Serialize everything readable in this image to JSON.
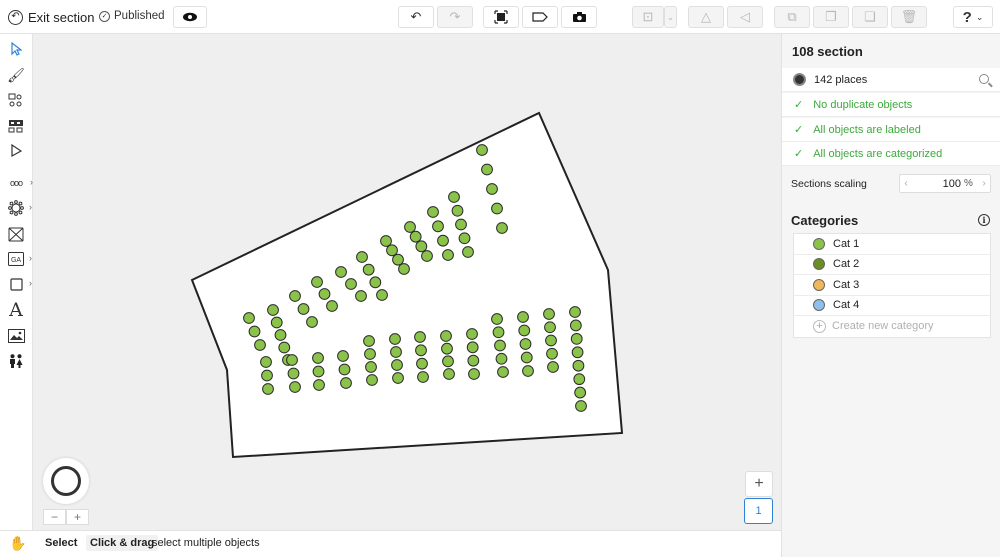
{
  "topbar": {
    "exit_label": "Exit section",
    "published_label": "Published",
    "help_label": "?"
  },
  "icons": {
    "eye": "eye-icon",
    "undo": "undo-icon",
    "redo": "redo-icon",
    "select_seats": "select-seats-icon",
    "label": "label-icon",
    "camera": "camera-icon",
    "align": "align-icon",
    "flip_horizontal": "flip-horizontal-icon",
    "flip_vertical": "flip-vertical-icon",
    "group": "group-icon",
    "duplicate": "duplicate-icon",
    "paste": "paste-icon",
    "trash": "trash-icon"
  },
  "left_tools": {
    "text_tool": "A"
  },
  "canvas": {
    "background_color": "#efefef",
    "seat_color": "#8bc34a",
    "zoom_minus": "−",
    "zoom_plus": "+",
    "floor_add": "+",
    "floor_number": "1"
  },
  "statusbar": {
    "key1": "Select",
    "key2": "Click & drag",
    "desc2": "select multiple objects"
  },
  "panel": {
    "title": "108 section",
    "places_count": "142",
    "places_label": "places",
    "checks": [
      "No duplicate objects",
      "All objects are labeled",
      "All objects are categorized"
    ],
    "scaling_label": "Sections scaling",
    "scaling_value": "100",
    "scaling_unit": "%",
    "categories_title": "Categories",
    "categories": [
      {
        "name": "Cat 1",
        "color": "#8bc34a"
      },
      {
        "name": "Cat 2",
        "color": "#6b8e23"
      },
      {
        "name": "Cat 3",
        "color": "#f2b75b"
      },
      {
        "name": "Cat 4",
        "color": "#8ec0ea"
      }
    ],
    "create_category": "Create new category"
  }
}
